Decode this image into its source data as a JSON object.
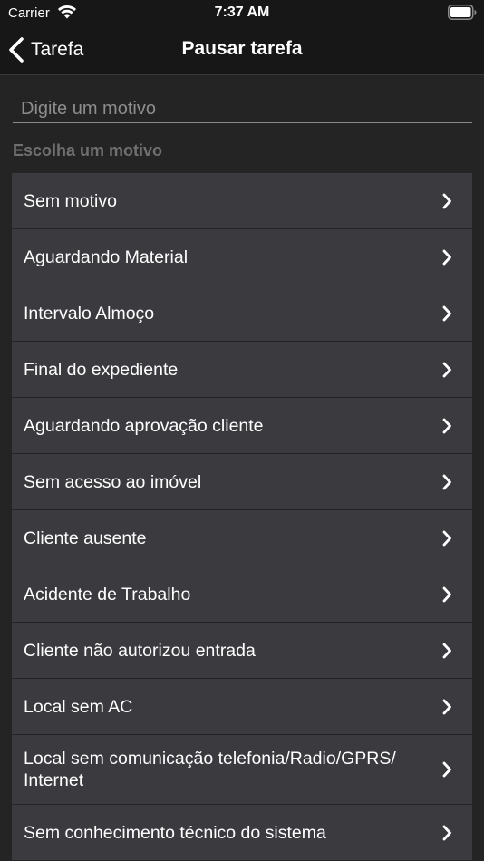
{
  "status_bar": {
    "carrier": "Carrier",
    "time": "7:37 AM"
  },
  "nav": {
    "back_label": "Tarefa",
    "title": "Pausar tarefa"
  },
  "reason_input": {
    "value": "",
    "placeholder": "Digite um motivo"
  },
  "section_header": "Escolha um motivo",
  "reasons": [
    {
      "label": "Sem motivo"
    },
    {
      "label": "Aguardando Material"
    },
    {
      "label": "Intervalo Almoço"
    },
    {
      "label": "Final do expediente"
    },
    {
      "label": "Aguardando aprovação cliente"
    },
    {
      "label": "Sem acesso ao imóvel"
    },
    {
      "label": "Cliente ausente"
    },
    {
      "label": "Acidente de Trabalho"
    },
    {
      "label": "Cliente não autorizou entrada"
    },
    {
      "label": "Local sem AC"
    },
    {
      "label": "Local sem comunicação telefonia/Radio/GPRS/ Internet"
    },
    {
      "label": "Sem conhecimento técnico do sistema"
    }
  ],
  "icons": {
    "wifi": "wifi-icon",
    "battery": "battery-icon",
    "back": "chevron-left-icon",
    "row_chevron": "chevron-right-icon"
  },
  "colors": {
    "background": "#242424",
    "bar_background": "#171717",
    "row_background": "#3a3a3f",
    "section_header": "#6f6f6f",
    "placeholder": "#8d8d8d"
  }
}
